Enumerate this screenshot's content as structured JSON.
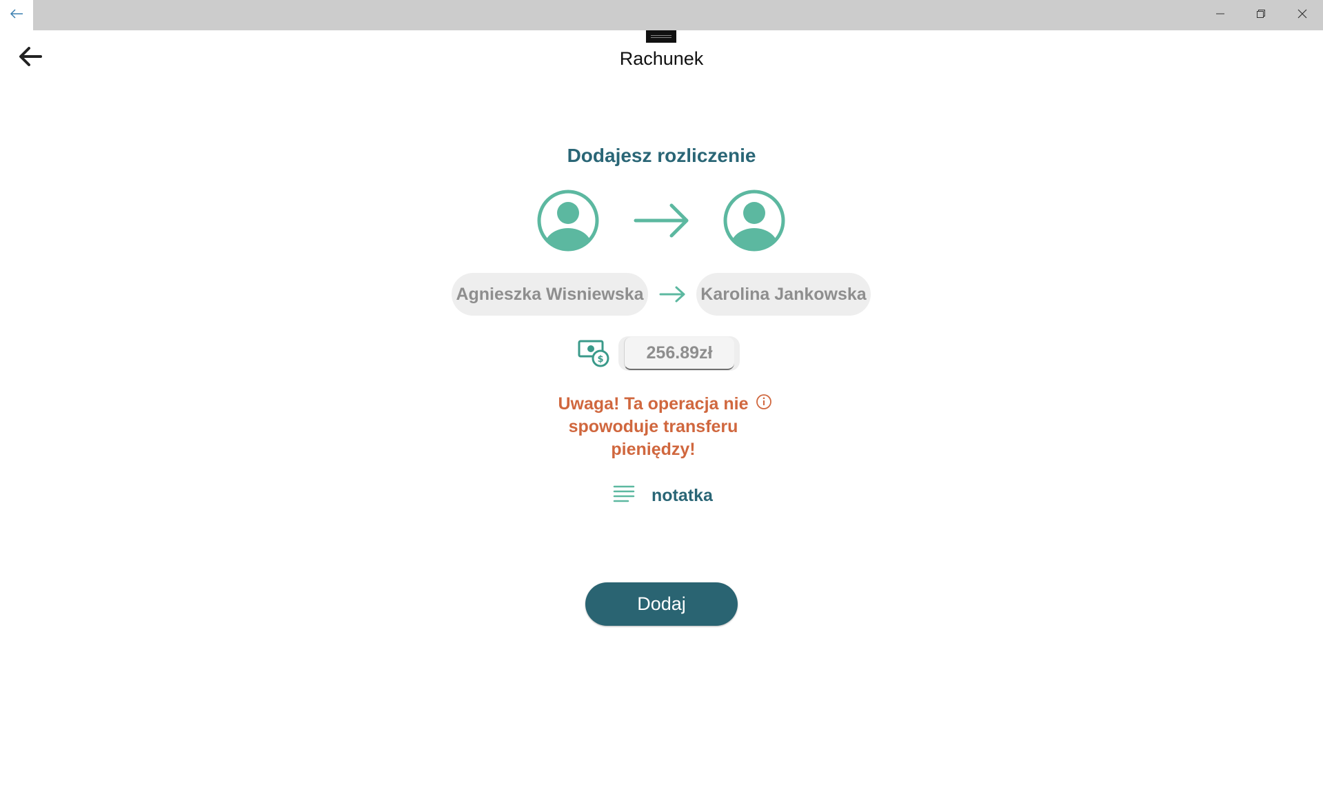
{
  "window": {
    "back_icon": "arrow-left-icon",
    "minimize_icon": "minimize-icon",
    "restore_icon": "restore-icon",
    "close_icon": "close-icon"
  },
  "header": {
    "title": "Rachunek",
    "back_icon": "arrow-left-icon"
  },
  "main": {
    "heading": "Dodajesz rozliczenie",
    "from_person": "Agnieszka Wisniewska",
    "to_person": "Karolina Jankowska",
    "amount": "256.89zł",
    "warning": "Uwaga! Ta operacja nie spowoduje transferu pieniędzy!",
    "note_label": "notatka",
    "add_button_label": "Dodaj"
  },
  "colors": {
    "accent_teal": "#5cb8a0",
    "heading_teal": "#2a6676",
    "warning_orange": "#d0673e",
    "button_bg": "#2a6472"
  }
}
